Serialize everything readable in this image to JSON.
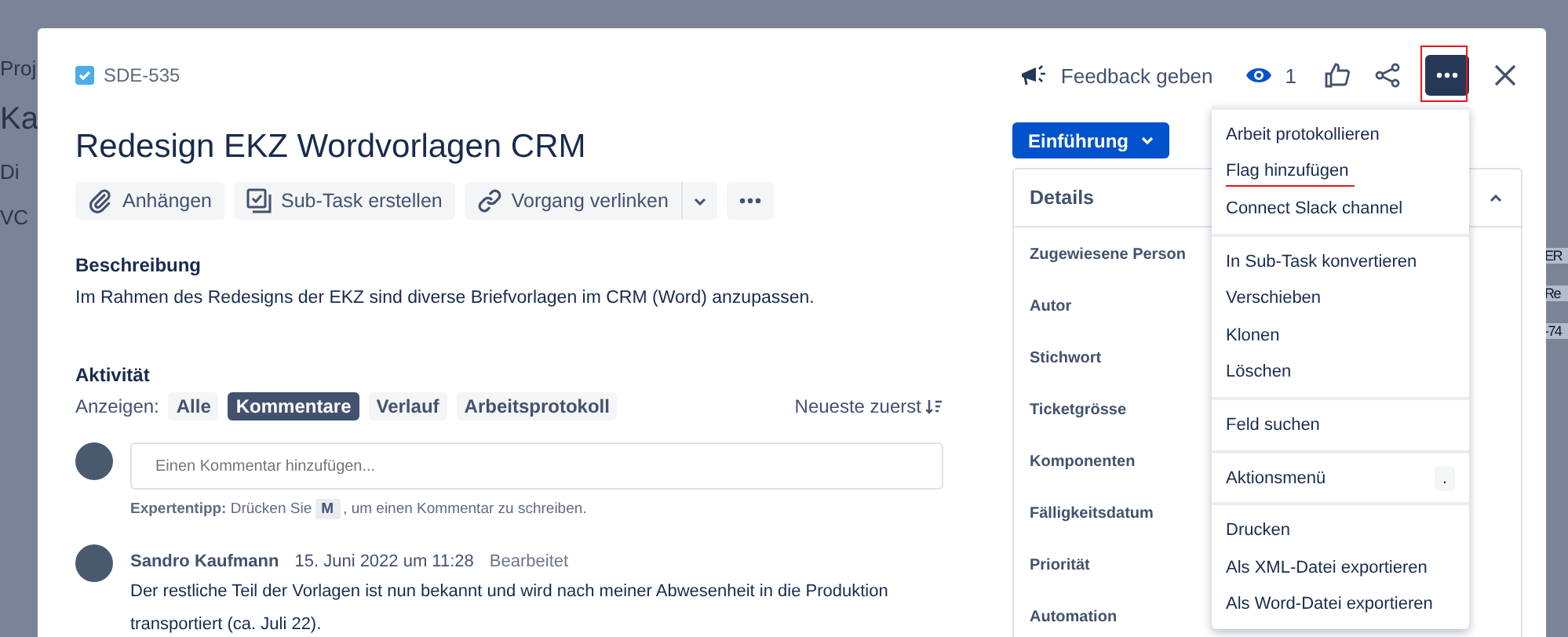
{
  "backdrop": {
    "left_fragments": [
      "Proj",
      "Ka",
      "Di",
      "VC"
    ],
    "right_fragments": [
      "ER",
      "Re",
      "-74"
    ]
  },
  "issue": {
    "key": "SDE-535",
    "title": "Redesign EKZ Wordvorlagen CRM"
  },
  "header_actions": {
    "feedback": "Feedback geben",
    "watchers": "1",
    "more_annotated": true
  },
  "toolbar": [
    {
      "label": "Anhängen",
      "kind": "paperclip"
    },
    {
      "label": "Sub-Task erstellen",
      "kind": "subtask"
    },
    {
      "label": "Vorgang verlinken",
      "kind": "link"
    }
  ],
  "description": {
    "heading": "Beschreibung",
    "text": "Im Rahmen des Redesigns der EKZ sind diverse Briefvorlagen im CRM (Word) anzupassen."
  },
  "activity": {
    "heading": "Aktivität",
    "filter_label": "Anzeigen:",
    "filters": [
      {
        "label": "Alle",
        "selected": false
      },
      {
        "label": "Kommentare",
        "selected": true
      },
      {
        "label": "Verlauf",
        "selected": false
      },
      {
        "label": "Arbeitsprotokoll",
        "selected": false
      }
    ],
    "sort": "Neueste zuerst",
    "comment_field": {
      "placeholder": "Einen Kommentar hinzufügen..."
    },
    "tip": {
      "text": "**Expertentipp:** Drücken Sie",
      "key": "M",
      "rest": ", um einen Kommentar zu schreiben."
    },
    "comments": [
      {
        "author": "Sandro Kaufmann",
        "date": "15. Juni 2022 um 11:28",
        "edited": "Bearbeitet",
        "text": "Der restliche Teil der Vorlagen ist nun bekannt und wird nach meiner Abwesenheit in die Produktion transportiert (ca. Juli 22)."
      }
    ]
  },
  "status_button": "Einführung",
  "details": {
    "heading": "Details",
    "expanded": true,
    "fields": [
      "Zugewiesene Person",
      "Autor",
      "Stichwort",
      "Ticketgrösse",
      "Komponenten",
      "Fälligkeitsdatum",
      "Priorität",
      "Automation"
    ]
  },
  "menu": {
    "groups": [
      [
        {
          "label": "Arbeit protokollieren",
          "annotated": false
        },
        {
          "label": "Flag hinzufügen",
          "annotated": true
        },
        {
          "label": "Connect Slack channel",
          "annotated": false
        }
      ],
      [
        {
          "label": "In Sub-Task konvertieren",
          "annotated": false
        },
        {
          "label": "Verschieben",
          "annotated": false
        },
        {
          "label": "Klonen",
          "annotated": false
        },
        {
          "label": "Löschen",
          "annotated": false
        }
      ],
      [
        {
          "label": "Feld suchen",
          "annotated": false
        }
      ],
      [
        {
          "label": "Aktionsmenü",
          "annotated": false,
          "shortcut": "."
        }
      ],
      [
        {
          "label": "Drucken",
          "annotated": false
        },
        {
          "label": "Als XML-Datei exportieren",
          "annotated": false
        },
        {
          "label": "Als Word-Datei exportieren",
          "annotated": false
        }
      ]
    ]
  }
}
